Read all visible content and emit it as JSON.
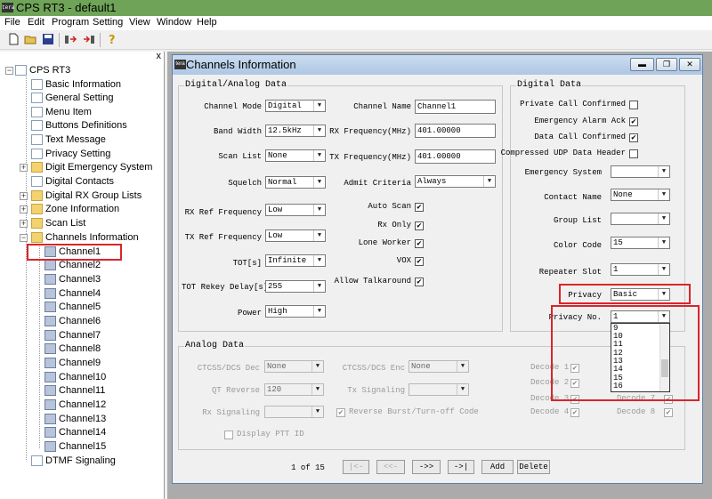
{
  "app": {
    "title": "CPS RT3 - default1",
    "icon_text": "tera"
  },
  "menu": [
    "File",
    "Edit",
    "Program",
    "Setting",
    "View",
    "Window",
    "Help"
  ],
  "toolbar_icons": [
    "new-file-icon",
    "open-folder-icon",
    "save-icon",
    "read-from-radio-icon",
    "write-to-radio-icon",
    "help-icon"
  ],
  "tree": {
    "close": "x",
    "root": "CPS RT3",
    "items": [
      "Basic Information",
      "General Setting",
      "Menu Item",
      "Buttons Definitions",
      "Text Message",
      "Privacy Setting",
      "Digit Emergency System",
      "Digital Contacts",
      "Digital RX Group Lists",
      "Zone Information",
      "Scan List",
      "Channels Information"
    ],
    "channels": [
      "Channel1",
      "Channel2",
      "Channel3",
      "Channel4",
      "Channel5",
      "Channel6",
      "Channel7",
      "Channel8",
      "Channel9",
      "Channel10",
      "Channel11",
      "Channel12",
      "Channel13",
      "Channel14",
      "Channel15"
    ],
    "last": "DTMF Signaling",
    "plus": "+",
    "minus": "−"
  },
  "window": {
    "title": "Channels Information",
    "buttons": {
      "minimize": "▬",
      "restore": "❐",
      "close": "✕"
    }
  },
  "digital_analog": {
    "title": "Digital/Analog Data",
    "channel_mode": {
      "label": "Channel Mode",
      "value": "Digital"
    },
    "band_width": {
      "label": "Band Width",
      "value": "12.5kHz"
    },
    "scan_list": {
      "label": "Scan List",
      "value": "None"
    },
    "squelch": {
      "label": "Squelch",
      "value": "Normal"
    },
    "rx_ref": {
      "label": "RX Ref Frequency",
      "value": "Low"
    },
    "tx_ref": {
      "label": "TX Ref Frequency",
      "value": "Low"
    },
    "tot": {
      "label": "TOT[s]",
      "value": "Infinite"
    },
    "tot_rekey": {
      "label": "TOT Rekey Delay[s]",
      "value": "255"
    },
    "power": {
      "label": "Power",
      "value": "High"
    },
    "channel_name": {
      "label": "Channel Name",
      "value": "Channel1"
    },
    "rx_freq": {
      "label": "RX Frequency(MHz)",
      "value": "401.00000"
    },
    "tx_freq": {
      "label": "TX Frequency(MHz)",
      "value": "401.00000"
    },
    "admit": {
      "label": "Admit Criteria",
      "value": "Always"
    },
    "auto_scan": {
      "label": "Auto Scan",
      "checked": true
    },
    "rx_only": {
      "label": "Rx Only",
      "checked": true
    },
    "lone_worker": {
      "label": "Lone Worker",
      "checked": true
    },
    "vox": {
      "label": "VOX",
      "checked": true
    },
    "talkaround": {
      "label": "Allow Talkaround",
      "checked": true
    }
  },
  "digital": {
    "title": "Digital Data",
    "private_call": {
      "label": "Private Call Confirmed",
      "checked": false
    },
    "emergency_ack": {
      "label": "Emergency Alarm Ack",
      "checked": true
    },
    "data_call": {
      "label": "Data Call Confirmed",
      "checked": true
    },
    "udp_header": {
      "label": "Compressed UDP Data Header",
      "checked": false
    },
    "emergency_system": {
      "label": "Emergency System",
      "value": ""
    },
    "contact_name": {
      "label": "Contact Name",
      "value": "None"
    },
    "group_list": {
      "label": "Group List",
      "value": ""
    },
    "color_code": {
      "label": "Color Code",
      "value": "15"
    },
    "repeater_slot": {
      "label": "Repeater Slot",
      "value": "1"
    },
    "privacy": {
      "label": "Privacy",
      "value": "Basic"
    },
    "privacy_no": {
      "label": "Privacy No.",
      "value": "1",
      "options": [
        "9",
        "10",
        "11",
        "12",
        "13",
        "14",
        "15",
        "16"
      ]
    }
  },
  "analog": {
    "title": "Analog Data",
    "ctcss_dec": {
      "label": "CTCSS/DCS Dec",
      "value": "None"
    },
    "ctcss_enc": {
      "label": "CTCSS/DCS Enc",
      "value": "None"
    },
    "qt_reverse": {
      "label": "QT Reverse",
      "value": "120"
    },
    "tx_signaling": {
      "label": "Tx Signaling",
      "value": ""
    },
    "rx_signaling": {
      "label": "Rx Signaling",
      "value": ""
    },
    "reverse_burst": {
      "label": "Reverse Burst/Turn-off Code",
      "checked": true
    },
    "display_ptt": {
      "label": "Display PTT ID",
      "checked": false
    },
    "decode1": "Decode 1",
    "decode2": "Decode 2",
    "decode3": "Decode 3",
    "decode4": "Decode 4",
    "decode7": "Decode 7",
    "decode8": "Decode 8"
  },
  "nav": {
    "page": "1 of 15",
    "first": "|<-",
    "prev": "<<-",
    "next": "->>",
    "last": "->|",
    "add": "Add",
    "delete": "Delete"
  },
  "arrow": "▼",
  "check": "✔",
  "colors": {
    "titlebar": "#6fa458",
    "highlight": "#d9252c",
    "mdi_background": "#ababab"
  }
}
